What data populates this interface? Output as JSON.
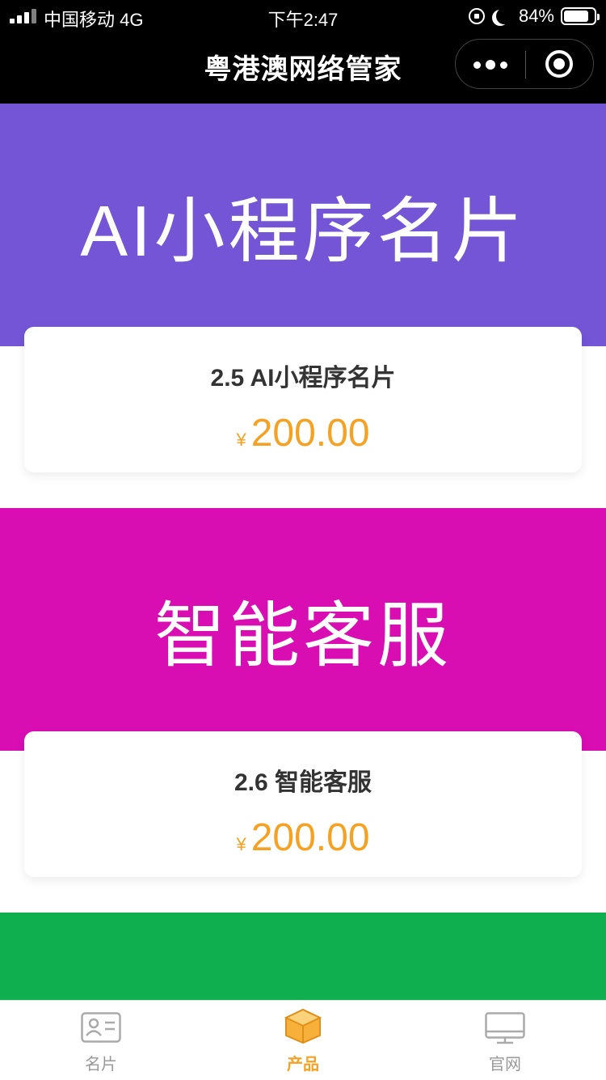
{
  "status": {
    "carrier": "中国移动 4G",
    "time": "下午2:47",
    "battery": "84%",
    "battery_level": 0.84
  },
  "nav": {
    "title": "粤港澳网络管家"
  },
  "products": [
    {
      "banner_text": "AI小程序名片",
      "banner_color": "#7355d6",
      "title": "2.5 AI小程序名片",
      "currency": "¥",
      "price": "200.00"
    },
    {
      "banner_text": "智能客服",
      "banner_color": "#d80eb3",
      "title": "2.6 智能客服",
      "currency": "¥",
      "price": "200.00"
    }
  ],
  "next_banner_color": "#0fae4e",
  "colors": {
    "accent": "#f5a122",
    "inactive": "#999999"
  },
  "tabbar": {
    "tabs": [
      {
        "label": "名片",
        "icon": "contact-card-icon",
        "active": false
      },
      {
        "label": "产品",
        "icon": "product-box-icon",
        "active": true
      },
      {
        "label": "官网",
        "icon": "monitor-icon",
        "active": false
      }
    ]
  }
}
